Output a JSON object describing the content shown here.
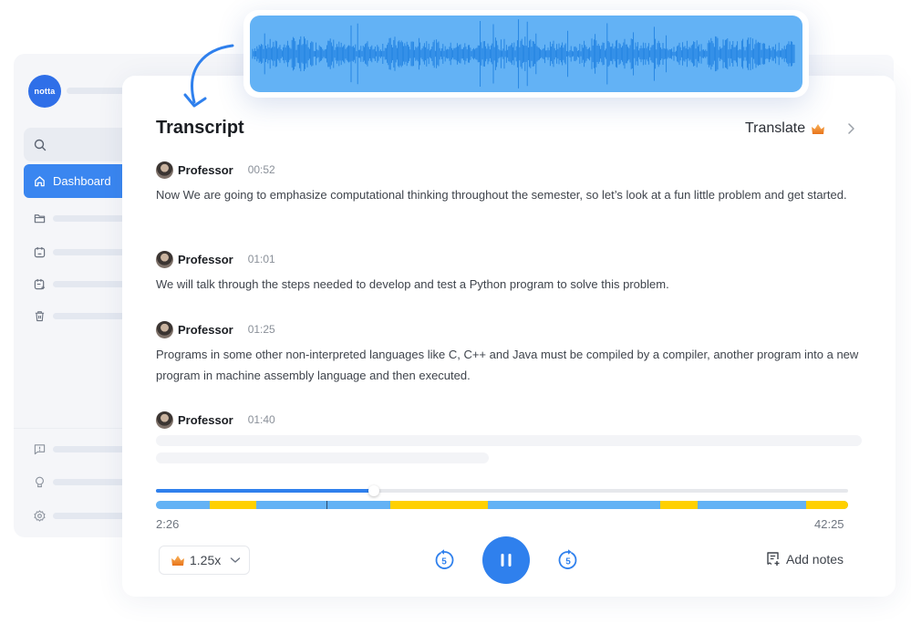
{
  "sidebar": {
    "logo_text": "notta",
    "active_item": {
      "label": "Dashboard",
      "icon": "home-icon"
    },
    "items": [
      {
        "icon": "folder-icon"
      },
      {
        "icon": "calendar-icon"
      },
      {
        "icon": "calendar-edit-icon"
      },
      {
        "icon": "trash-icon"
      }
    ],
    "bottom_items": [
      {
        "icon": "feedback-icon"
      },
      {
        "icon": "lightbulb-icon"
      },
      {
        "icon": "gear-icon"
      }
    ]
  },
  "transcript": {
    "title": "Transcript",
    "translate_label": "Translate",
    "entries": [
      {
        "speaker": "Professor",
        "time": "00:52",
        "text": "Now We are going to emphasize computational thinking throughout the semester, so let’s look at a fun little problem and get started."
      },
      {
        "speaker": "Professor",
        "time": "01:01",
        "text": "We will talk through the steps needed to develop and test a Python program to solve this problem."
      },
      {
        "speaker": "Professor",
        "time": "01:25",
        "text": "Programs in some other non-interpreted languages like C, C++ and Java must be compiled by a compiler, another program into a new program in machine assembly language and then executed."
      },
      {
        "speaker": "Professor",
        "time": "01:40",
        "text": ""
      }
    ]
  },
  "player": {
    "current_time": "2:26",
    "total_time": "42:25",
    "progress": 0.315,
    "segments": [
      {
        "start": 0.078,
        "end": 0.145,
        "color": "#ffd000"
      },
      {
        "start": 0.338,
        "end": 0.48,
        "color": "#ffd000"
      },
      {
        "start": 0.728,
        "end": 0.782,
        "color": "#ffd000"
      },
      {
        "start": 0.94,
        "end": 1.0,
        "color": "#ffd000"
      }
    ],
    "marker": 0.246,
    "speed_label": "1.25x",
    "skip_back_seconds": "5",
    "skip_forward_seconds": "5",
    "add_notes_label": "Add notes"
  },
  "colors": {
    "accent": "#2f80ed",
    "waveform_bg": "#63b2f5",
    "waveform_fg": "#1a7de0",
    "highlight": "#ffd000",
    "premium": "#f08a24"
  }
}
